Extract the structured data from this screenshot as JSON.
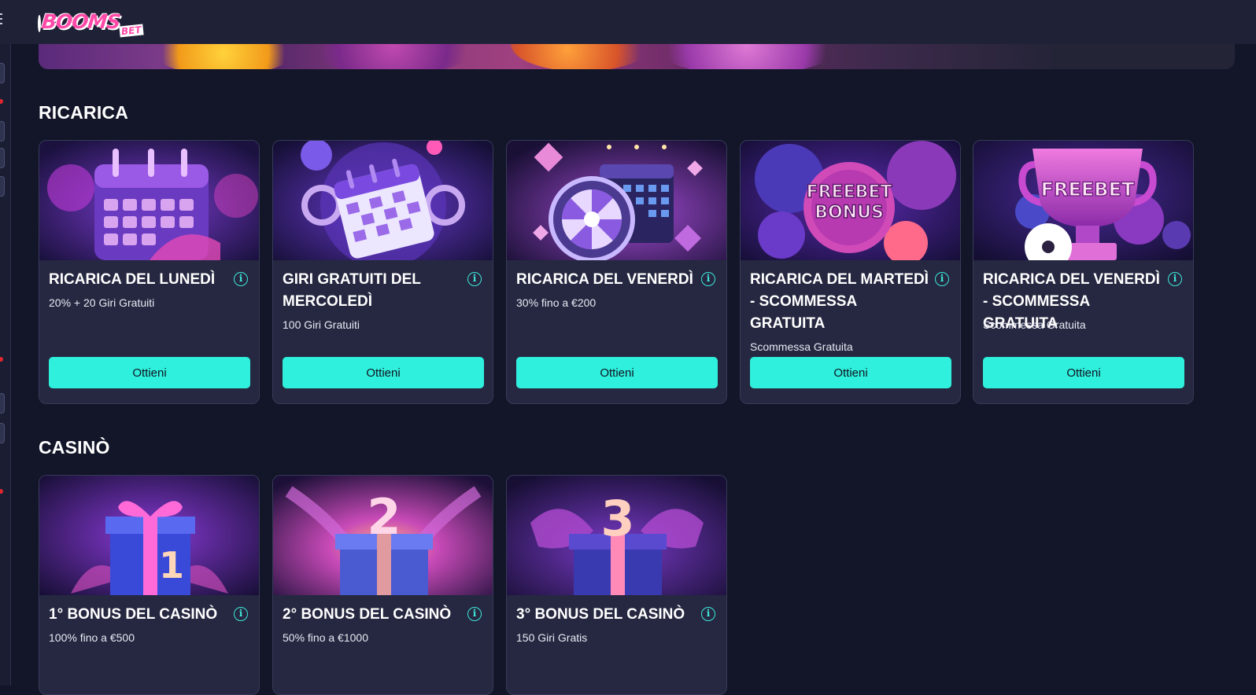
{
  "header": {
    "logo_text": "BOOMS",
    "logo_suffix": "BET"
  },
  "sections": [
    {
      "title": "RICARICA",
      "cards": [
        {
          "title": "RICARICA DEL LUNEDÌ",
          "subtitle": "20% + 20 Giri Gratuiti",
          "button": "Ottieni",
          "image_icon": "calendar-icon"
        },
        {
          "title": "GIRI GRATUITI DEL MERCOLEDÌ",
          "subtitle": "100 Giri Gratuiti",
          "button": "Ottieni",
          "image_icon": "calendar-spin-icon"
        },
        {
          "title": "RICARICA DEL VENERDÌ",
          "subtitle": "30% fino a €200",
          "button": "Ottieni",
          "image_icon": "wheel-calendar-icon"
        },
        {
          "title": "RICARICA DEL MARTEDÌ - SCOMMESSA GRATUITA",
          "subtitle": "Scommessa Gratuita",
          "button": "Ottieni",
          "image_icon": "freebet-balls-icon",
          "image_text": "FREEBET BONUS"
        },
        {
          "title": "RICARICA DEL VENERDÌ - SCOMMESSA GRATUITA",
          "subtitle": "Scommessa Gratuita",
          "button": "Ottieni",
          "image_icon": "freebet-trophy-icon",
          "image_text": "FREEBET"
        }
      ]
    },
    {
      "title": "CASINÒ",
      "cards": [
        {
          "title": "1° BONUS DEL CASINÒ",
          "subtitle": "100% fino a €500",
          "image_icon": "gift-1-icon",
          "image_text": "1"
        },
        {
          "title": "2° BONUS DEL CASINÒ",
          "subtitle": "50% fino a €1000",
          "image_icon": "gift-2-icon",
          "image_text": "2"
        },
        {
          "title": "3° BONUS DEL CASINÒ",
          "subtitle": "150 Giri Gratis",
          "image_icon": "gift-3-icon",
          "image_text": "3"
        }
      ]
    }
  ],
  "colors": {
    "background": "#131629",
    "card": "#252840",
    "accent": "#2ff0dc",
    "brand": "#ff4aa8"
  }
}
